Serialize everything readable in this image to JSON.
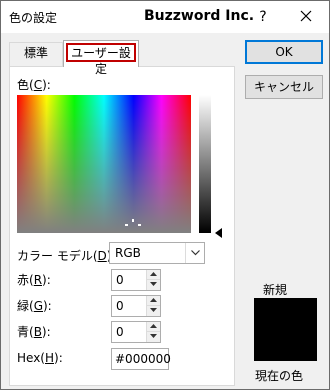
{
  "window": {
    "title": "色の設定",
    "brand": "Buzzword Inc.",
    "help": "?"
  },
  "tabs": [
    {
      "label": "標準",
      "selected": false
    },
    {
      "label": "ユーザー設定",
      "selected": true
    }
  ],
  "buttons": {
    "ok": "OK",
    "cancel": "キャンセル"
  },
  "color": {
    "label_prefix": "色(",
    "label_key": "C",
    "label_suffix": "):"
  },
  "model": {
    "label_prefix": "カラー モデル(",
    "label_key": "D",
    "label_suffix": "):",
    "selected": "RGB"
  },
  "fields": {
    "red": {
      "label_prefix": "赤(",
      "key": "R",
      "label_suffix": "):",
      "value": "0"
    },
    "green": {
      "label_prefix": "緑(",
      "key": "G",
      "label_suffix": "):",
      "value": "0"
    },
    "blue": {
      "label_prefix": "青(",
      "key": "B",
      "label_suffix": "):",
      "value": "0"
    },
    "hex": {
      "label_prefix": "Hex(",
      "key": "H",
      "label_suffix": "):",
      "value": "#000000"
    }
  },
  "preview": {
    "new_label": "新規",
    "current_label": "現在の色",
    "color": "#000000"
  }
}
